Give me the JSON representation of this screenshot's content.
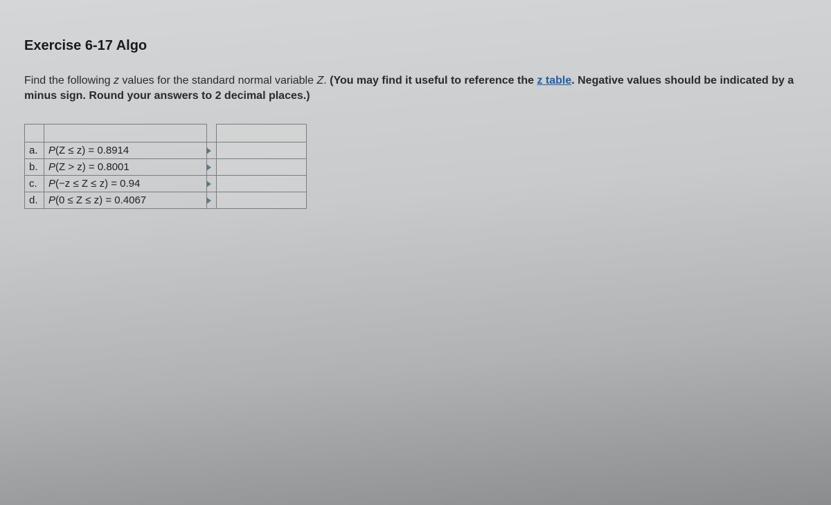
{
  "title": "Exercise 6-17 Algo",
  "prompt": {
    "lead": "Find the following ",
    "z1": "z",
    "mid1": " values for the standard normal variable ",
    "Zvar": "Z",
    "period": ". ",
    "boldA": "(You may find it useful to reference the ",
    "link": "z table",
    "boldB": ". Negative values should be indicated by a minus sign. Round your answers to 2 decimal places.)"
  },
  "rows": [
    {
      "label": "a.",
      "expr_pre": "P",
      "expr_inner": "(Z ≤ z)",
      "expr_post": " = 0.8914"
    },
    {
      "label": "b.",
      "expr_pre": "P",
      "expr_inner": "(Z > z)",
      "expr_post": " = 0.8001"
    },
    {
      "label": "c.",
      "expr_pre": "P",
      "expr_inner": "(−z ≤ Z ≤ z)",
      "expr_post": " = 0.94"
    },
    {
      "label": "d.",
      "expr_pre": "P",
      "expr_inner": "(0 ≤ Z ≤ z)",
      "expr_post": " = 0.4067"
    }
  ]
}
